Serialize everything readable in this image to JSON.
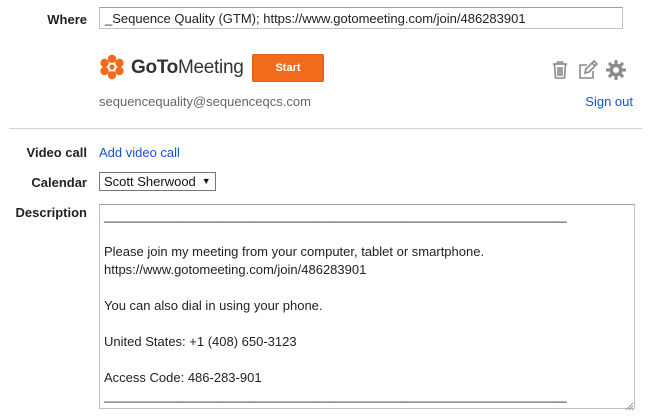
{
  "where": {
    "label": "Where",
    "value": "_Sequence Quality (GTM); https://www.gotomeeting.com/join/486283901"
  },
  "gotomeeting": {
    "logo_bold": "GoTo",
    "logo_light": "Meeting",
    "start_label": "Start",
    "account_email": "sequencequality@sequenceqcs.com",
    "signout_label": "Sign out",
    "brand_color": "#f26a1b",
    "icons": [
      "trash-icon",
      "edit-icon",
      "gear-icon"
    ]
  },
  "video_call": {
    "label": "Video call",
    "link": "Add video call"
  },
  "calendar": {
    "label": "Calendar",
    "selected": "Scott Sherwood"
  },
  "description": {
    "label": "Description",
    "text": "________________________________________________________________\n\nPlease join my meeting from your computer, tablet or smartphone.\nhttps://www.gotomeeting.com/join/486283901\n\nYou can also dial in using your phone.\n\nUnited States: +1 (408) 650-3123\n\nAccess Code: 486-283-901\n________________________________________________________________"
  },
  "colors": {
    "link": "#1155cc",
    "label": "#222222",
    "divider": "#d3d3d3"
  }
}
